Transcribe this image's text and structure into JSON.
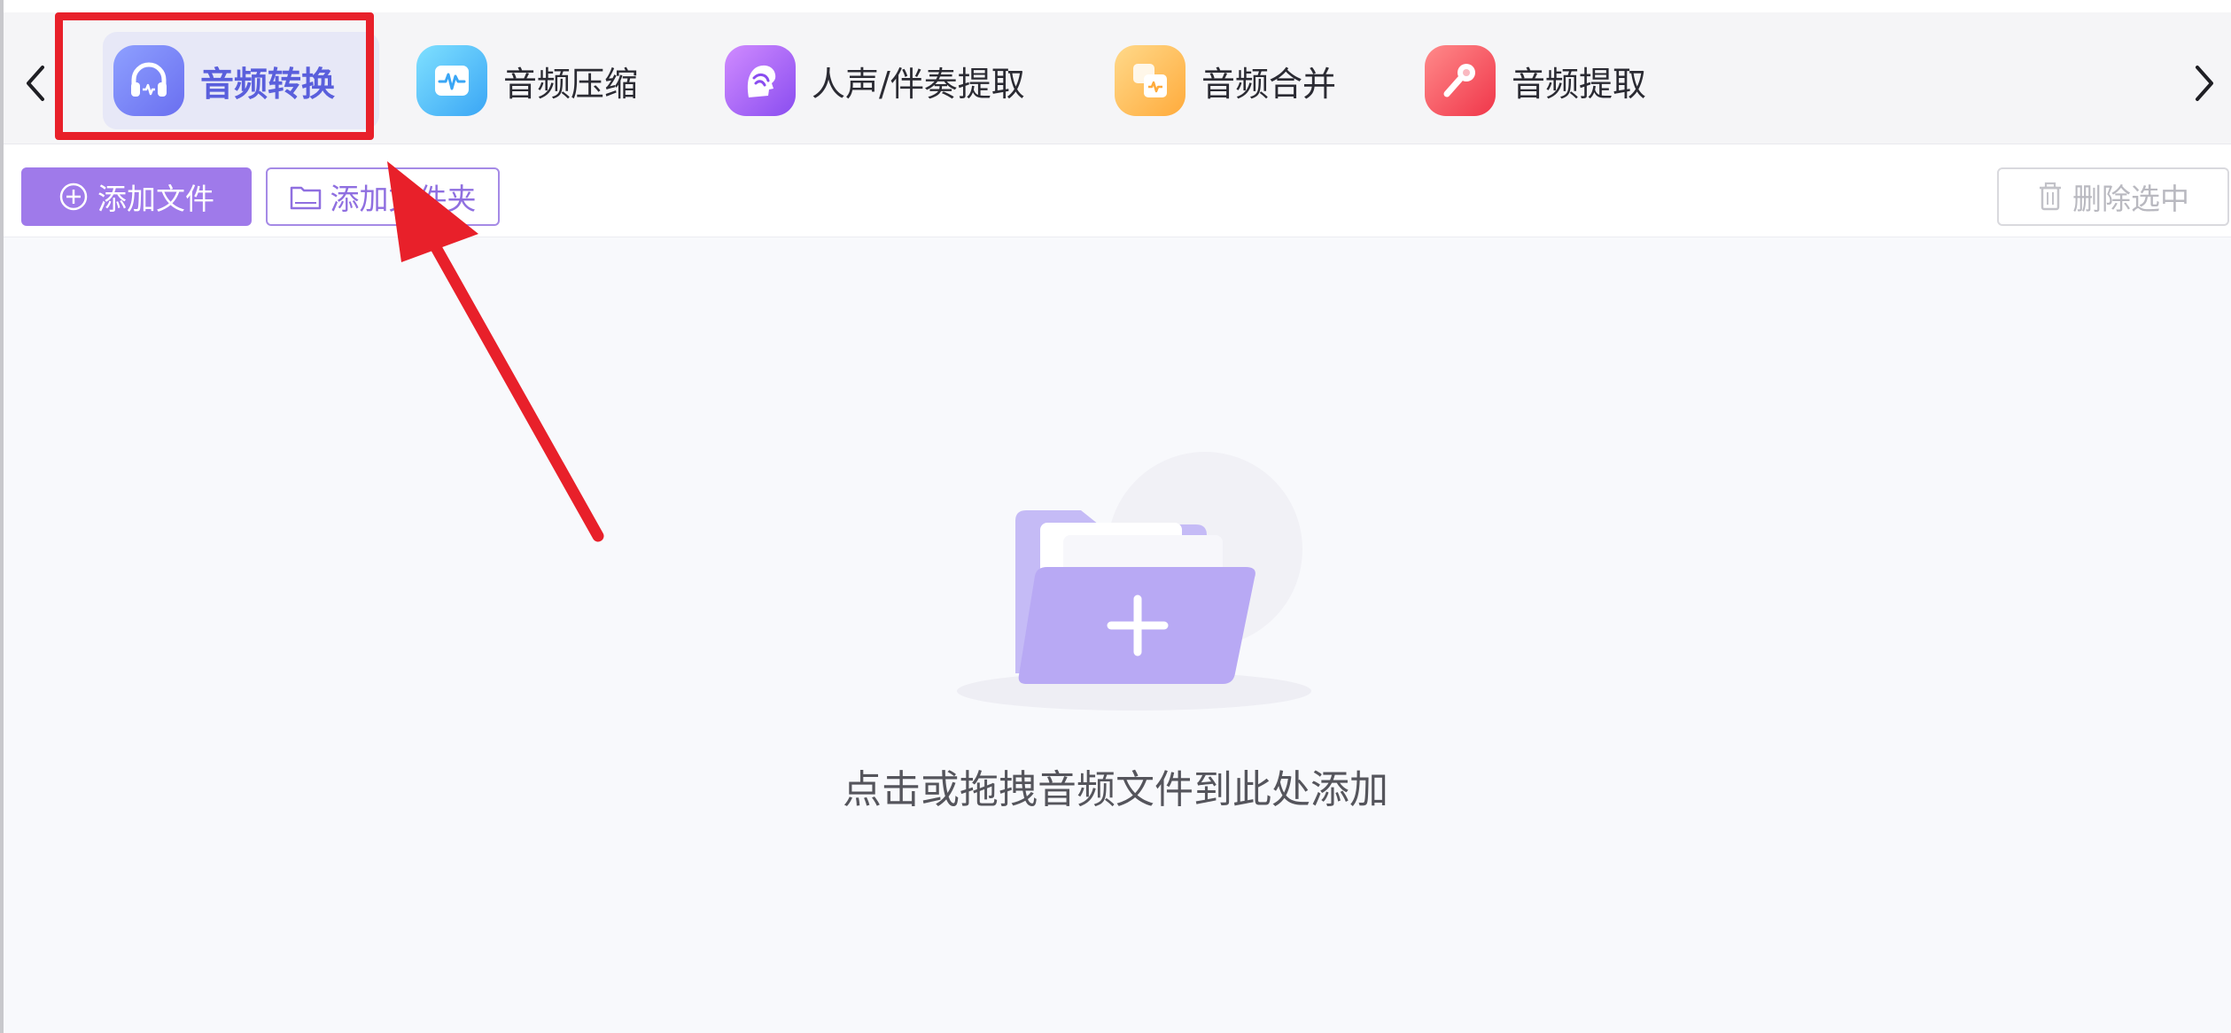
{
  "tabbar": {
    "tabs": [
      {
        "label": "音频转换",
        "icon": "headphones-icon",
        "active": true
      },
      {
        "label": "音频压缩",
        "icon": "waveform-icon",
        "active": false
      },
      {
        "label": "人声/伴奏提取",
        "icon": "voice-profile-icon",
        "active": false
      },
      {
        "label": "音频合并",
        "icon": "merge-icon",
        "active": false
      },
      {
        "label": "音频提取",
        "icon": "microphone-icon",
        "active": false
      }
    ],
    "prev_icon": "chevron-left-icon",
    "next_icon": "chevron-right-icon"
  },
  "toolbar": {
    "add_file_label": "添加文件",
    "add_folder_label": "添加文件夹",
    "delete_selected_label": "删除选中"
  },
  "drop_zone": {
    "hint": "点击或拖拽音频文件到此处添加",
    "icon": "folder-plus-icon"
  },
  "annotation": {
    "highlight_color": "#e8202a"
  },
  "colors": {
    "accent": "#9f7aea",
    "active_tab_text": "#5a5fdc",
    "background": "#f8f9fc"
  }
}
